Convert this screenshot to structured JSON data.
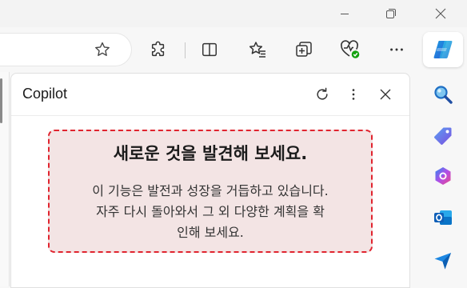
{
  "window": {
    "controls": [
      {
        "name": "minimize",
        "icon": "minimize-icon"
      },
      {
        "name": "restore",
        "icon": "restore-icon"
      },
      {
        "name": "close",
        "icon": "close-icon"
      }
    ]
  },
  "toolbar": {
    "icons": [
      "favorite-star-icon",
      "extensions-icon",
      "split-screen-icon",
      "favorites-icon",
      "collections-icon",
      "browser-essentials-icon",
      "more-options-icon",
      "copilot-icon"
    ]
  },
  "copilot_pane": {
    "title": "Copilot",
    "header_icons": [
      "refresh-icon",
      "more-vertical-icon",
      "close-icon"
    ],
    "notice": {
      "title": "새로운 것을 발견해 보세요.",
      "body_line1": "이 기능은 발전과 성장을 거듭하고 있습니다.",
      "body_line2": "자주 다시 돌아와서 그 외 다양한 계획을 확",
      "body_line3": "인해 보세요."
    }
  },
  "sidebar": {
    "icons": [
      "search-icon",
      "shopping-tag-icon",
      "microsoft365-icon",
      "outlook-icon",
      "send-icon"
    ]
  },
  "colors": {
    "notice_border": "#e0242f",
    "notice_background": "#f3e4e4",
    "accent": "#0f6cbd"
  }
}
